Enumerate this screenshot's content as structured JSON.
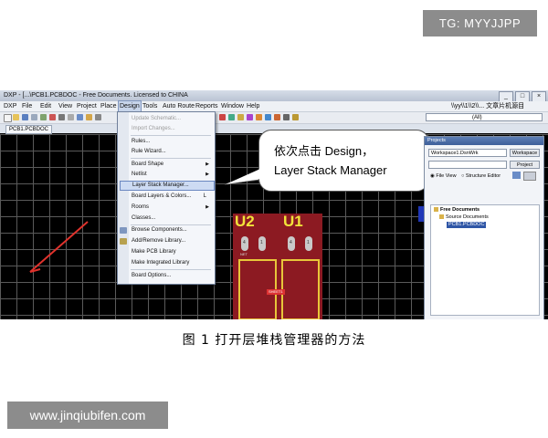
{
  "watermarks": {
    "top": "TG: MYYJJPP",
    "bottom": "www.jinqiubifen.com"
  },
  "window": {
    "title": "DXP - [...\\PCB1.PCBDOC - Free Documents. Licensed to CHINA",
    "menu": [
      "DXP",
      "File",
      "Edit",
      "View",
      "Project",
      "Place",
      "Design",
      "Tools",
      "Auto Route",
      "Reports",
      "Window",
      "Help"
    ],
    "active_menu": "Design",
    "path_text": "\\\\yy\\\\1\\\\2\\\\...  文章片机源目",
    "layer_combo": "(All)"
  },
  "doc_tab": "PCB1.PCBDOC",
  "design_menu": [
    {
      "label": "Update Schematic...",
      "disabled": true
    },
    {
      "label": "Import Changes...",
      "disabled": true
    },
    {
      "label": "Rules..."
    },
    {
      "label": "Rule Wizard..."
    },
    {
      "label": "Board Shape",
      "submenu": true
    },
    {
      "label": "Netlist",
      "submenu": true
    },
    {
      "label": "Layer Stack Manager...",
      "highlighted": true
    },
    {
      "label": "Board Layers & Colors...",
      "shortcut": "L"
    },
    {
      "label": "Rooms",
      "submenu": true
    },
    {
      "label": "Classes..."
    },
    {
      "label": "Browse Components..."
    },
    {
      "label": "Add/Remove Library..."
    },
    {
      "label": "Make PCB Library"
    },
    {
      "label": "Make Integrated Library"
    },
    {
      "label": "Board Options..."
    }
  ],
  "callout": {
    "line1": "依次点击  Design，",
    "line2": "Layer Stack Manager"
  },
  "board": {
    "u2": "U2",
    "u1": "U1",
    "sheet_label": "SHEET1",
    "pad1": "1",
    "pad4": "4",
    "small": "NET"
  },
  "projects_panel": {
    "title": "Projects",
    "workspace": "Workspace1.DsnWrk",
    "workspace_btn": "Workspace",
    "project_btn": "Project",
    "file_view": "File View",
    "structure_editor": "Structure Editor",
    "tree": {
      "root": "Free Documents",
      "folder": "Source Documents",
      "file": "PCB1.PCBDOC"
    }
  },
  "caption": "图  1  打开层堆栈管理器的方法"
}
